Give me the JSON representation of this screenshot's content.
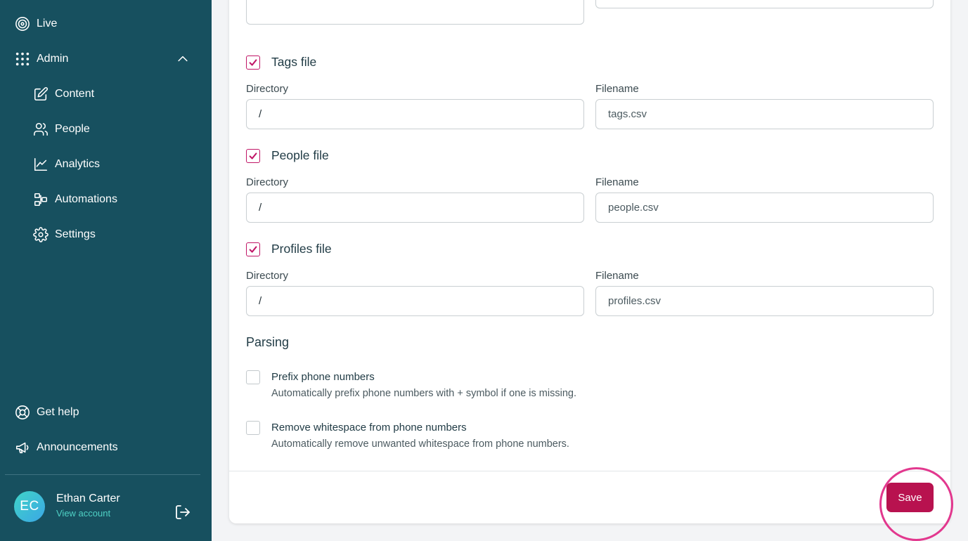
{
  "sidebar": {
    "nav": {
      "live": "Live",
      "admin": "Admin",
      "content": "Content",
      "people": "People",
      "analytics": "Analytics",
      "automations": "Automations",
      "settings": "Settings",
      "get_help": "Get help",
      "announcements": "Announcements"
    },
    "user": {
      "initials": "EC",
      "name": "Ethan Carter",
      "link": "View account"
    }
  },
  "form": {
    "files": [
      {
        "label": "Tags file",
        "checked": true,
        "directory_label": "Directory",
        "directory_value": "/",
        "filename_label": "Filename",
        "filename_value": "tags.csv"
      },
      {
        "label": "People file",
        "checked": true,
        "directory_label": "Directory",
        "directory_value": "/",
        "filename_label": "Filename",
        "filename_value": "people.csv"
      },
      {
        "label": "Profiles file",
        "checked": true,
        "directory_label": "Directory",
        "directory_value": "/",
        "filename_label": "Filename",
        "filename_value": "profiles.csv"
      }
    ],
    "parsing": {
      "title": "Parsing",
      "options": [
        {
          "title": "Prefix phone numbers",
          "description": "Automatically prefix phone numbers with + symbol if one is missing.",
          "checked": false
        },
        {
          "title": "Remove whitespace from phone numbers",
          "description": "Automatically remove unwanted whitespace from phone numbers.",
          "checked": false
        }
      ]
    },
    "save_label": "Save"
  },
  "colors": {
    "sidebar_bg": "#17505f",
    "accent": "#b8124f",
    "checkbox": "#c01566",
    "link": "#4fd1c5"
  }
}
